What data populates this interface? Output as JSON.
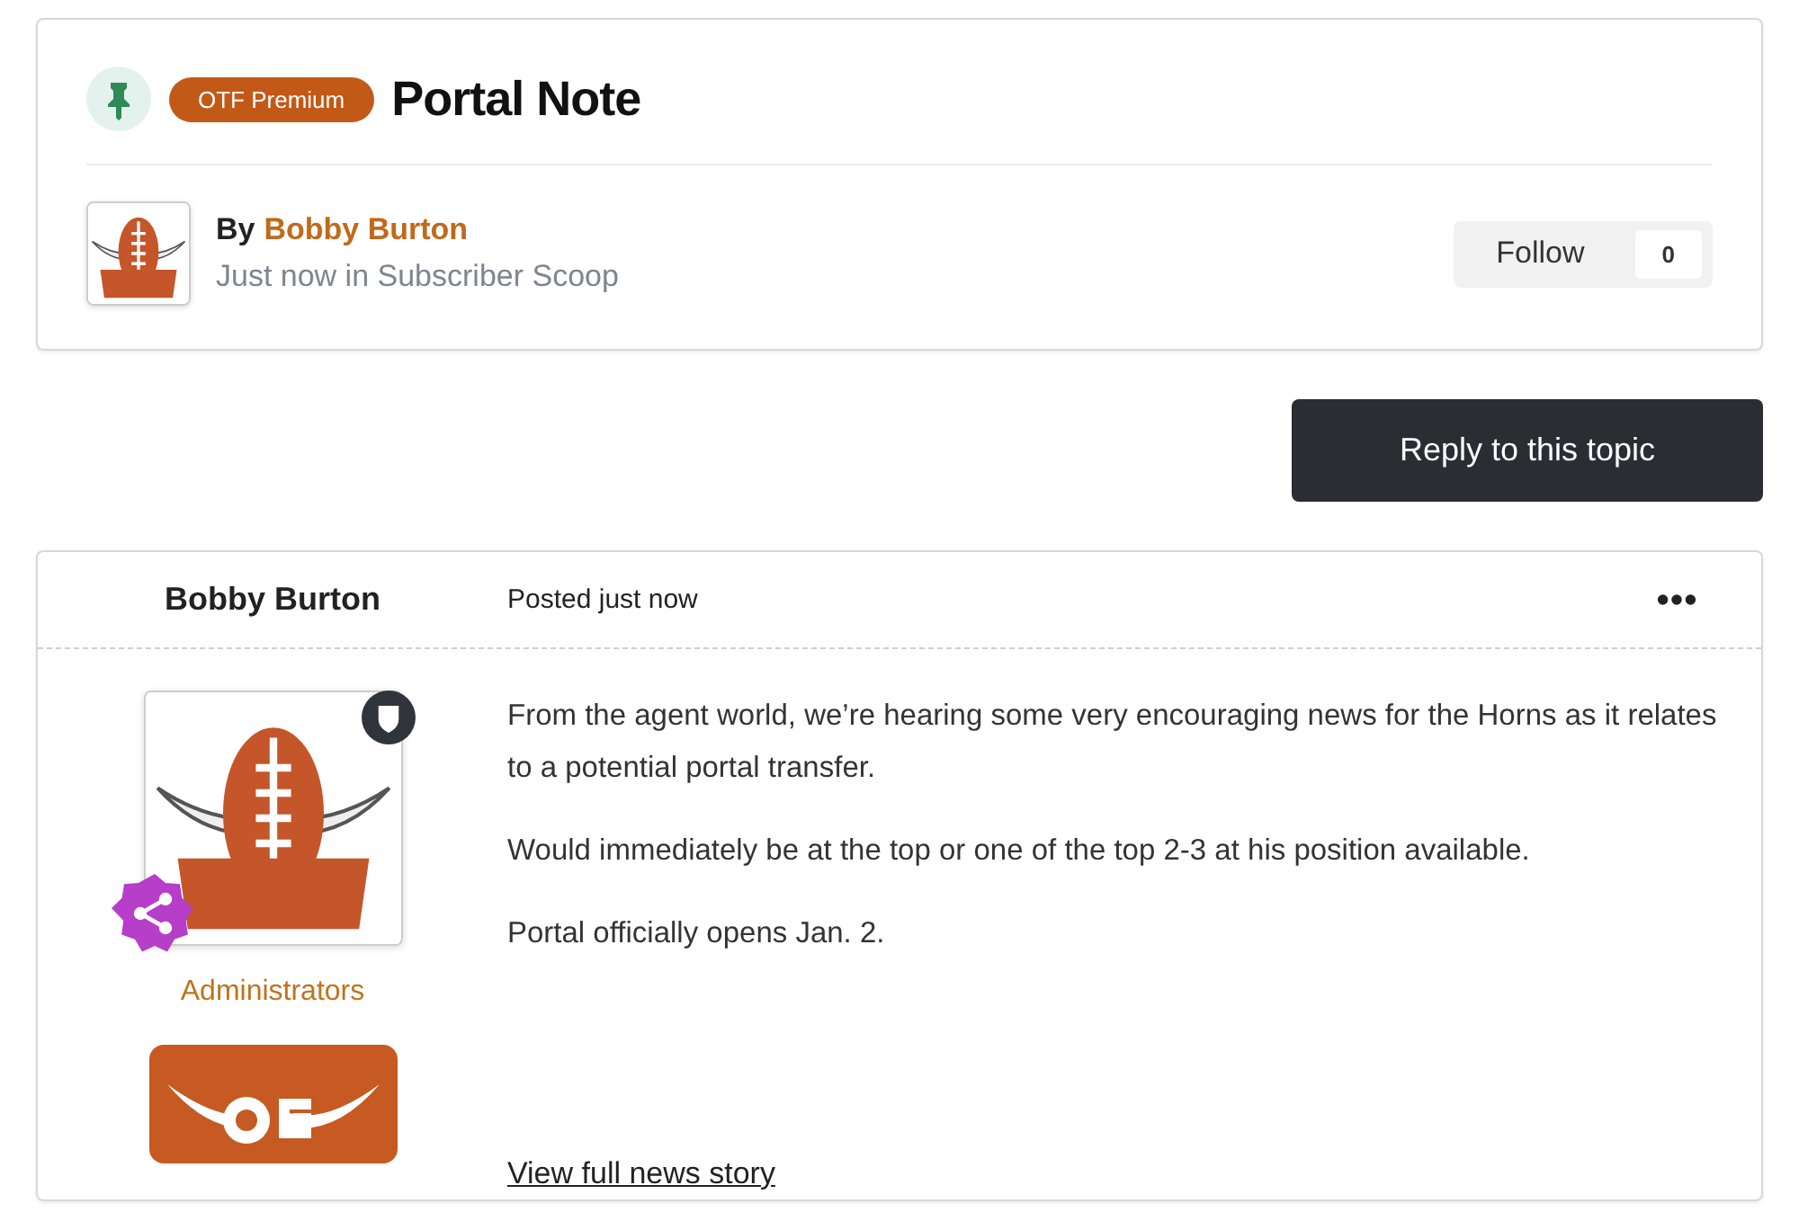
{
  "topic_header": {
    "pinned": true,
    "badge": "OTF Premium",
    "title": "Portal Note",
    "byline_prefix": "By",
    "author": "Bobby Burton",
    "meta": "Just now in Subscriber Scoop",
    "follow": {
      "label": "Follow",
      "count": "0"
    }
  },
  "reply_button": "Reply to this topic",
  "post": {
    "author": "Bobby Burton",
    "posted": "Posted just now",
    "group": "Administrators",
    "paragraphs": [
      "From the agent world, we’re hearing some very encouraging news for the Horns as it relates to a potential portal transfer.",
      "Would immediately be at the top or one of the top 2-3 at his position available.",
      "Portal officially opens Jan. 2."
    ],
    "link": "View full news story"
  }
}
